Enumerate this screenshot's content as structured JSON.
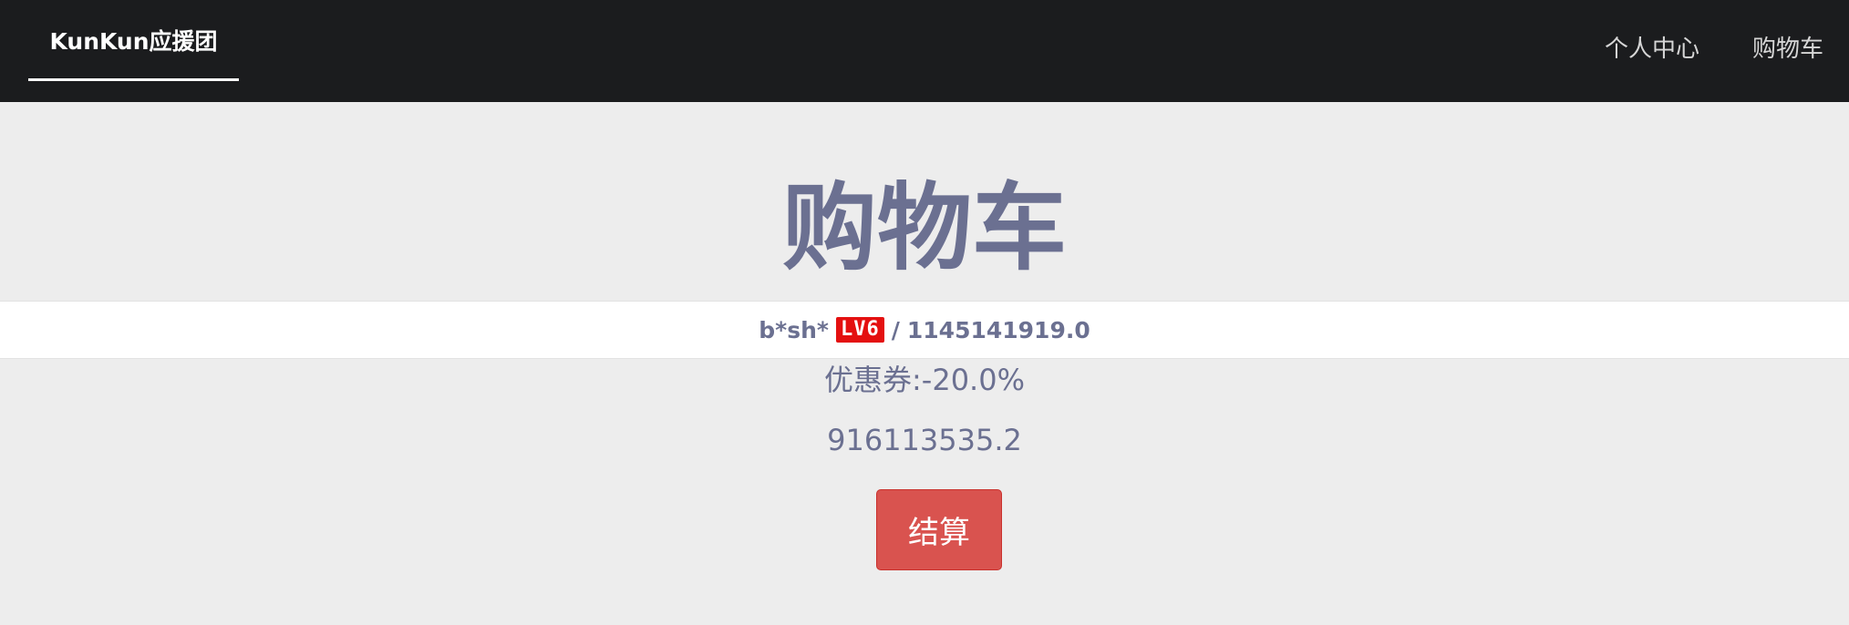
{
  "navbar": {
    "brand": "KunKun应援团",
    "links": [
      {
        "label": "个人中心"
      },
      {
        "label": "购物车"
      }
    ]
  },
  "main": {
    "title": "购物车",
    "user": {
      "name": "b*sh*",
      "level": "LV6",
      "separator": "/",
      "balance": "1145141919.0"
    },
    "coupon": "优惠券:-20.0%",
    "total": "916113535.2",
    "checkout_label": "结算"
  },
  "colors": {
    "navbar_bg": "#1b1c1e",
    "page_bg": "#ededed",
    "title": "#6b7091",
    "level_badge": "#e41010",
    "checkout_button": "#d9534f"
  }
}
